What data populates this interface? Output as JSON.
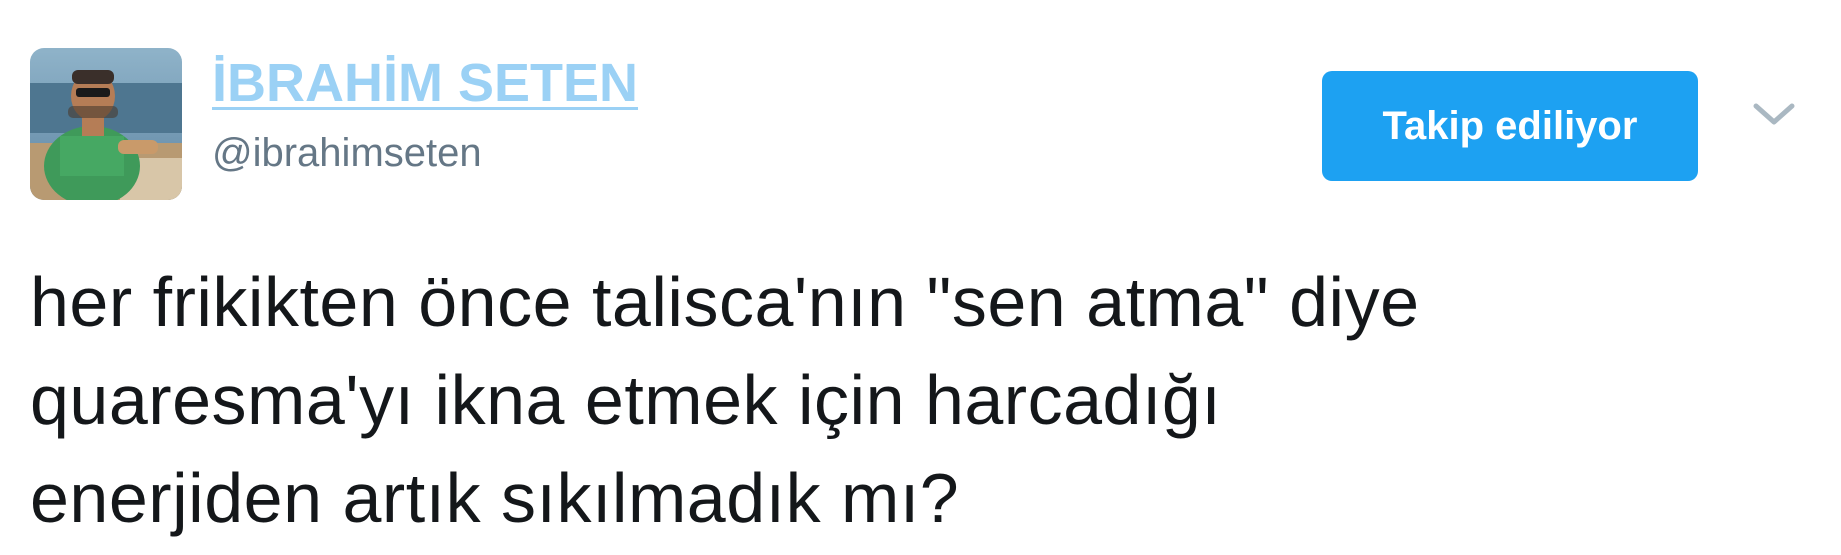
{
  "author": {
    "display_name": "İBRAHİM SETEN",
    "handle": "@ibrahimseten",
    "avatar_icon": "profile-photo"
  },
  "follow_button": {
    "label": "Takip ediliyor",
    "color": "#1da1f2"
  },
  "menu": {
    "caret_icon": "chevron-down-icon"
  },
  "tweet": {
    "lines": [
      "her frikikten önce talisca'nın \"sen atma\" diye",
      "quaresma'yı ikna etmek için harcadığı",
      "enerjiden artık sıkılmadık mı?"
    ]
  },
  "colors": {
    "name_link": "#9bd1f5",
    "handle": "#657786",
    "text": "#14171a"
  }
}
